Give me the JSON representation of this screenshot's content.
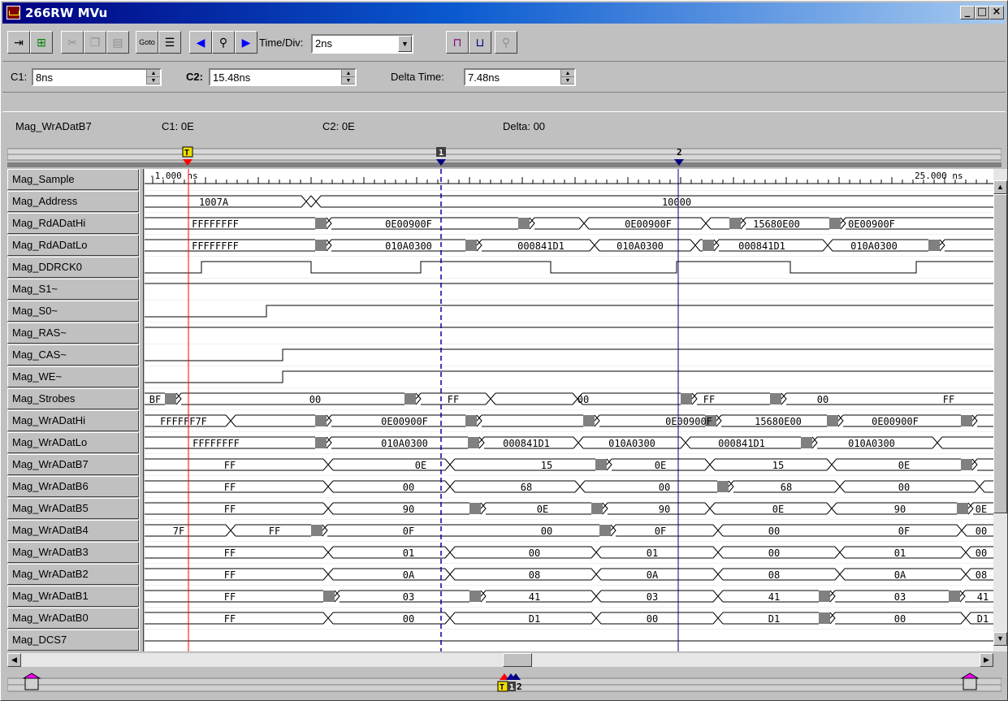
{
  "window": {
    "title": "266RW MVu",
    "controls": [
      "_",
      "□",
      "×"
    ]
  },
  "toolbar": {
    "time_div_label": "Time/Div:",
    "time_div_value": "2ns",
    "buttons": [
      "add-signal",
      "add-bus",
      "cut",
      "copy",
      "paste",
      "goto",
      "properties",
      "search-left",
      "find",
      "search-right",
      "zoom-full",
      "zoom-fit",
      "zoom-lens"
    ]
  },
  "cursors": {
    "c1_label": "C1:",
    "c1_value": "8ns",
    "c2_label": "C2:",
    "c2_value": "15.48ns",
    "delta_label": "Delta Time:",
    "delta_value": "7.48ns"
  },
  "info": {
    "signal": "Mag_WrADatB7",
    "c1": "C1: 0E",
    "c2": "C2: 0E",
    "delta": "Delta: 00"
  },
  "ruler": {
    "start_label": "-1.000 ns",
    "end_label": "25.000 ns",
    "trigger_marker": "T",
    "marker1": "1",
    "marker2": "2"
  },
  "signals": [
    "Mag_Sample",
    "Mag_Address",
    "Mag_RdADatHi",
    "Mag_RdADatLo",
    "Mag_DDRCK0",
    "Mag_S1~",
    "Mag_S0~",
    "Mag_RAS~",
    "Mag_CAS~",
    "Mag_WE~",
    "Mag_Strobes",
    "Mag_WrADatHi",
    "Mag_WrADatLo",
    "Mag_WrADatB7",
    "Mag_WrADatB6",
    "Mag_WrADatB5",
    "Mag_WrADatB4",
    "Mag_WrADatB3",
    "Mag_WrADatB2",
    "Mag_WrADatB1",
    "Mag_WrADatB0",
    "Mag_DCS7"
  ],
  "waveforms": {
    "Mag_Address": [
      [
        "1007A"
      ],
      [
        "10000"
      ]
    ],
    "Mag_RdADatHi": [
      "FFFFFFFF",
      "0E00900F",
      "0E00900F",
      "15680E00",
      "0E00900F"
    ],
    "Mag_RdADatLo": [
      "FFFFFFFF",
      "010A0300",
      "000841D1",
      "010A0300",
      "000841D1",
      "010A0300"
    ],
    "Mag_Strobes": [
      "BF",
      "00",
      "FF",
      "00",
      "FF",
      "00",
      "FF"
    ],
    "Mag_WrADatHi": [
      "FFFFFF7F",
      "0E00900F",
      "0E00900F",
      "15680E00",
      "0E00900F"
    ],
    "Mag_WrADatLo": [
      "FFFFFFFF",
      "010A0300",
      "000841D1",
      "010A0300",
      "000841D1",
      "010A0300"
    ],
    "Mag_WrADatB7": [
      "FF",
      "0E",
      "15",
      "0E",
      "15",
      "0E"
    ],
    "Mag_WrADatB6": [
      "FF",
      "00",
      "68",
      "00",
      "68",
      "00"
    ],
    "Mag_WrADatB5": [
      "FF",
      "90",
      "0E",
      "90",
      "0E",
      "90",
      "0E"
    ],
    "Mag_WrADatB4": [
      "7F",
      "FF",
      "0F",
      "00",
      "0F",
      "00",
      "0F",
      "00"
    ],
    "Mag_WrADatB3": [
      "FF",
      "01",
      "00",
      "01",
      "00",
      "01",
      "00"
    ],
    "Mag_WrADatB2": [
      "FF",
      "0A",
      "08",
      "0A",
      "08",
      "0A",
      "08"
    ],
    "Mag_WrADatB1": [
      "FF",
      "03",
      "41",
      "03",
      "41",
      "03",
      "41"
    ],
    "Mag_WrADatB0": [
      "FF",
      "00",
      "D1",
      "00",
      "D1",
      "00",
      "D1"
    ]
  },
  "overview": {
    "markers": [
      "T",
      "1",
      "2"
    ]
  },
  "colors": {
    "trigger": "#ff0000",
    "cursor1": "#0000a0",
    "cursor2": "#000080",
    "title_start": "#000080",
    "title_end": "#a6caf0"
  }
}
